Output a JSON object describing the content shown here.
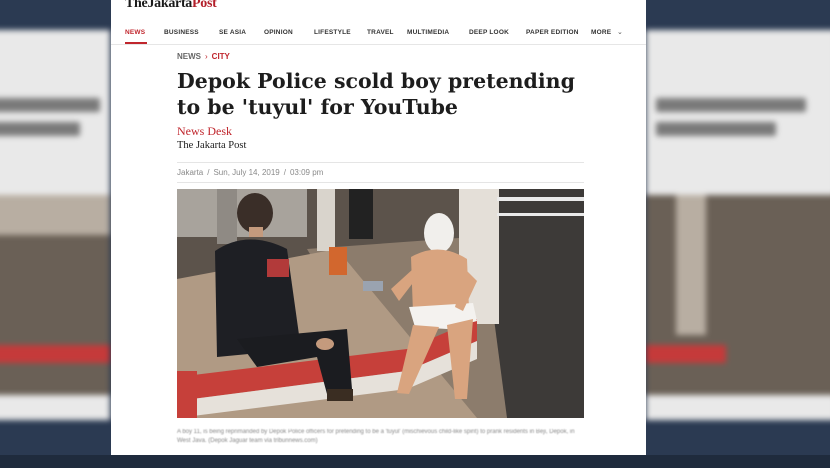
{
  "site": {
    "name_part1": "TheJakarta",
    "name_part2": "Post"
  },
  "nav": {
    "items": [
      "NEWS",
      "BUSINESS",
      "SE ASIA",
      "OPINION",
      "LIFESTYLE",
      "TRAVEL",
      "MULTIMEDIA",
      "DEEP LOOK",
      "PAPER EDITION",
      "MORE"
    ],
    "active": "NEWS"
  },
  "breadcrumb": {
    "section": "NEWS",
    "subsection": "CITY"
  },
  "article": {
    "headline": "Depok Police scold boy pretending to be 'tuyul' for YouTube",
    "author": "News Desk",
    "publication": "The Jakarta Post",
    "location": "Jakarta",
    "date": "Sun, July 14, 2019",
    "time": "03:09 pm"
  },
  "colors": {
    "accent": "#c0262d",
    "text": "#1d1d1d",
    "muted": "#8a8a8a",
    "background": "#2b3a52"
  }
}
